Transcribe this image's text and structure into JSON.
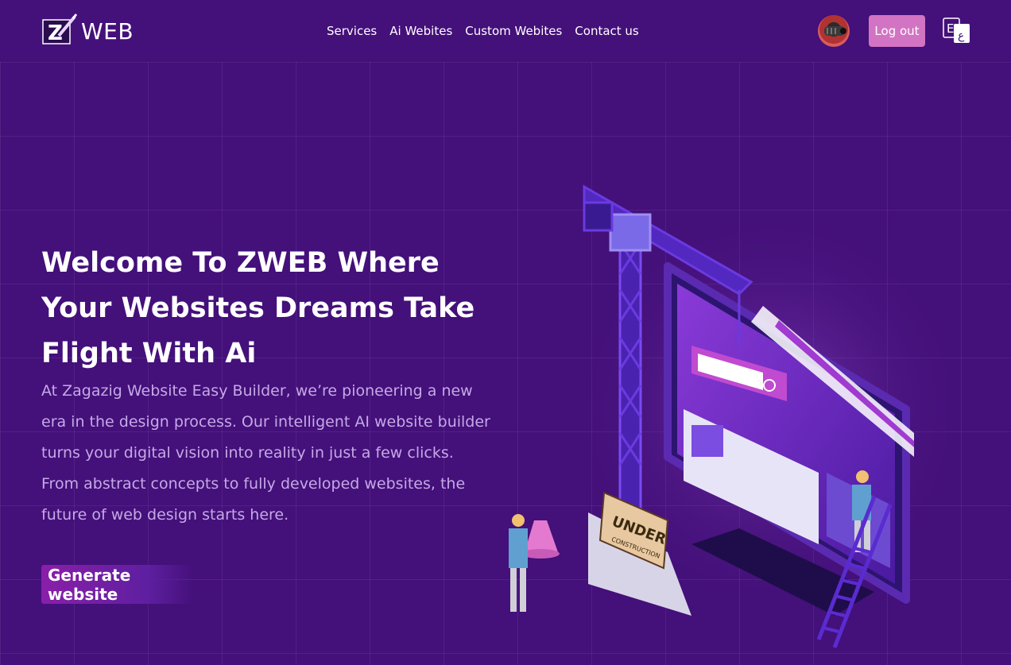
{
  "header": {
    "logo_text": "WEB",
    "nav": [
      "Services",
      "Ai Webites",
      "Custom Webites",
      "Contact us"
    ],
    "logout_label": "Log out",
    "language_icon": "translate-icon"
  },
  "hero": {
    "title": "Welcome To ZWEB Where Your Websites Dreams Take Flight With Ai",
    "description": "At Zagazig Website Easy Builder, we’re pioneering a new era in the design process. Our intelligent AI website builder turns your digital vision into reality in just a few clicks. From abstract concepts to fully developed websites, the future of web design starts here.",
    "cta_label": "Generate website"
  },
  "illustration": {
    "sign_line1": "UNDER",
    "sign_line2": "CONSTRUCTION"
  },
  "colors": {
    "background": "#44107a",
    "logout_button": "#d274c3",
    "description_text": "#c5a9e6",
    "accent": "#8a1fa8"
  }
}
